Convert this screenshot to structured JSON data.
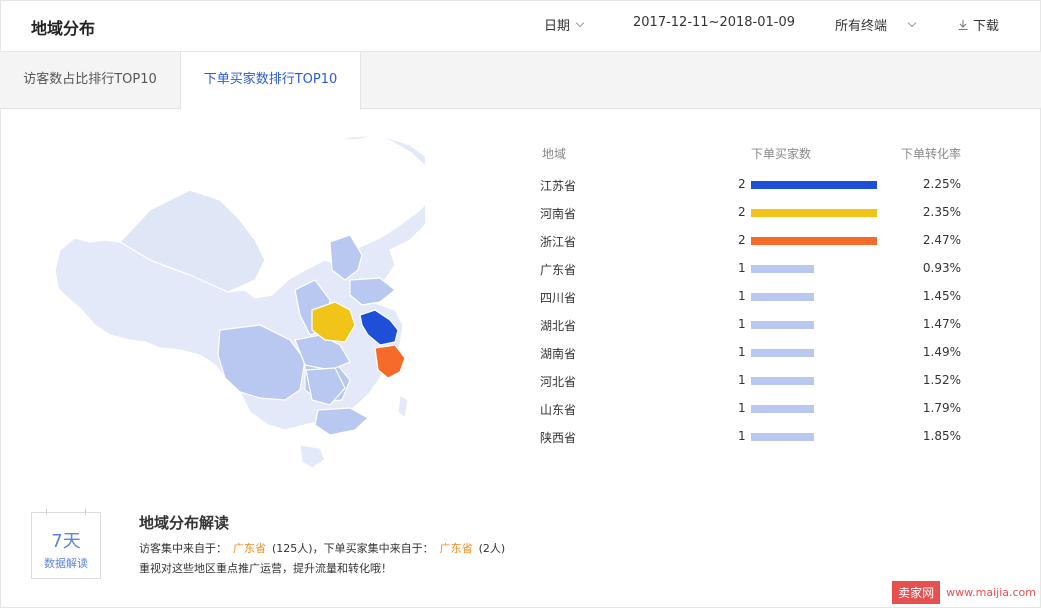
{
  "header": {
    "title": "地域分布",
    "period_label": "日期",
    "date_range": "2017-12-11~2018-01-09",
    "terminal": "所有终端",
    "download": "下载"
  },
  "tabs": [
    {
      "label": "访客数占比排行TOP10",
      "active": false
    },
    {
      "label": "下单买家数排行TOP10",
      "active": true
    }
  ],
  "table": {
    "headers": {
      "region": "地域",
      "buyers": "下单买家数",
      "rate": "下单转化率"
    },
    "rows": [
      {
        "region": "江苏省",
        "count": "2",
        "value": 2,
        "rate": "2.25%",
        "color": "#1f4fd6"
      },
      {
        "region": "河南省",
        "count": "2",
        "value": 2,
        "rate": "2.35%",
        "color": "#f0c419"
      },
      {
        "region": "浙江省",
        "count": "2",
        "value": 2,
        "rate": "2.47%",
        "color": "#f76b2a"
      },
      {
        "region": "广东省",
        "count": "1",
        "value": 1,
        "rate": "0.93%",
        "color": "#b8c8f0"
      },
      {
        "region": "四川省",
        "count": "1",
        "value": 1,
        "rate": "1.45%",
        "color": "#b8c8f0"
      },
      {
        "region": "湖北省",
        "count": "1",
        "value": 1,
        "rate": "1.47%",
        "color": "#b8c8f0"
      },
      {
        "region": "湖南省",
        "count": "1",
        "value": 1,
        "rate": "1.49%",
        "color": "#b8c8f0"
      },
      {
        "region": "河北省",
        "count": "1",
        "value": 1,
        "rate": "1.52%",
        "color": "#b8c8f0"
      },
      {
        "region": "山东省",
        "count": "1",
        "value": 1,
        "rate": "1.79%",
        "color": "#b8c8f0"
      },
      {
        "region": "陕西省",
        "count": "1",
        "value": 1,
        "rate": "1.85%",
        "color": "#b8c8f0"
      }
    ]
  },
  "interpretation": {
    "badge_days": "7天",
    "badge_label": "数据解读",
    "title": "地域分布解读",
    "line1_prefix": "访客集中来自于：",
    "visitor_region": "广东省",
    "visitor_count": "(125人)，下单买家集中来自于：",
    "buyer_region": "广东省",
    "buyer_count": "(2人)",
    "line2": "重视对这些地区重点推广运营，提升流量和转化哦！"
  },
  "watermark": {
    "brand": "卖家网",
    "url": "www.maijia.com"
  },
  "colors": {
    "accent": "#2a5bd7",
    "highlight": "#f08c1e",
    "map_base": "#e3e9f8",
    "map_mid": "#b8c8f0"
  }
}
